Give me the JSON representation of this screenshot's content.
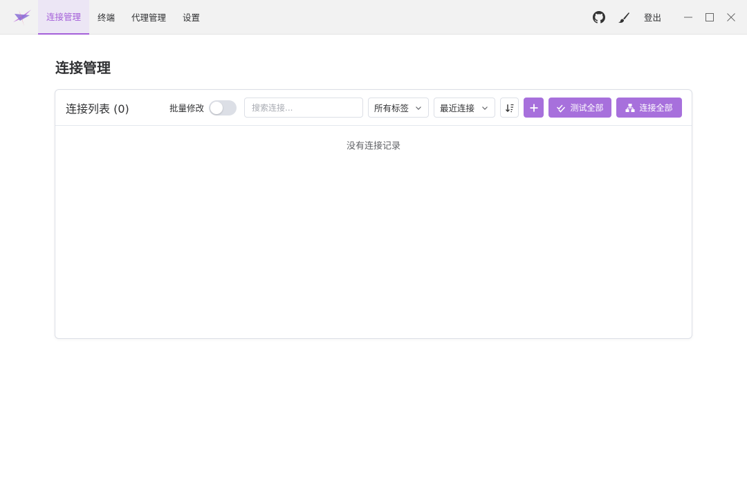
{
  "nav": {
    "tabs": [
      {
        "label": "连接管理",
        "active": true
      },
      {
        "label": "终端",
        "active": false
      },
      {
        "label": "代理管理",
        "active": false
      },
      {
        "label": "设置",
        "active": false
      }
    ]
  },
  "titlebar": {
    "logout_label": "登出",
    "icons": [
      "github-icon",
      "brush-icon",
      "minimize-icon",
      "maximize-icon",
      "close-icon"
    ]
  },
  "page": {
    "title": "连接管理"
  },
  "panel": {
    "title": "连接列表 (0)",
    "batch_edit_label": "批量修改",
    "batch_edit_enabled": false,
    "search": {
      "value": "",
      "placeholder": "搜索连接..."
    },
    "tag_filter": {
      "selected": "所有标签"
    },
    "sort_filter": {
      "selected": "最近连接"
    },
    "test_all_label": "测试全部",
    "connect_all_label": "连接全部",
    "empty_text": "没有连接记录"
  },
  "colors": {
    "accent": "#a770dc",
    "active_tab_text": "#a45fd9",
    "active_tab_bg": "#ece6f5"
  }
}
